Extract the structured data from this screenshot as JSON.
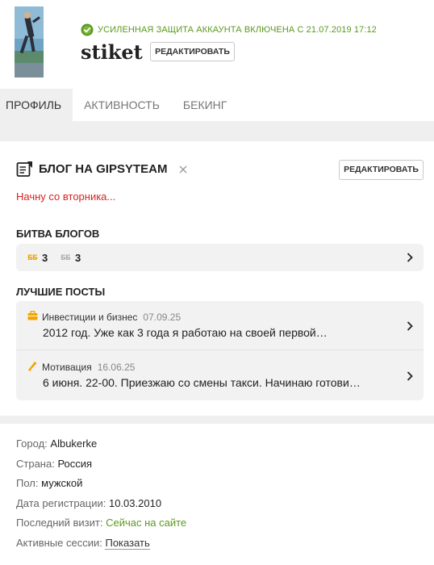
{
  "profile": {
    "security_notice": "Усиленная защита аккаунта включена с 21.07.2019 17:12",
    "username": "stiket",
    "edit_label": "Редактировать"
  },
  "tabs": [
    {
      "label": "Профиль",
      "active": true
    },
    {
      "label": "Активность",
      "active": false
    },
    {
      "label": "Бекинг",
      "active": false
    }
  ],
  "blog": {
    "title": "Блог на GipsyTeam",
    "edit_label": "Редактировать",
    "description": "Начну со вторника..."
  },
  "battle": {
    "title": "Битва блогов",
    "stat_gold": "3",
    "stat_silver": "3"
  },
  "best_posts": {
    "title": "Лучшие посты",
    "items": [
      {
        "category": "Инвестиции и бизнес",
        "date": "07.09.25",
        "text": "2012 год. Уже как 3 года я работаю на своей первой…",
        "icon": "briefcase-icon"
      },
      {
        "category": "Мотивация",
        "date": "16.06.25",
        "text": "6 июня. 22-00. Приезжаю со смены такси. Начинаю готови…",
        "icon": "motivation-icon"
      }
    ]
  },
  "info": {
    "city_label": "Город:",
    "city": "Albukerke",
    "country_label": "Страна:",
    "country": "Россия",
    "gender_label": "Пол:",
    "gender": "мужской",
    "reg_label": "Дата регистрации:",
    "reg": "10.03.2010",
    "visit_label": "Последний визит:",
    "visit": "Сейчас на сайте",
    "sessions_label": "Активные сессии:",
    "sessions": "Показать"
  },
  "colors": {
    "accent_green": "#5a9a1e",
    "alert_red": "#d92121",
    "gold": "#f0a500",
    "panel_grey": "#f2f2f2"
  }
}
